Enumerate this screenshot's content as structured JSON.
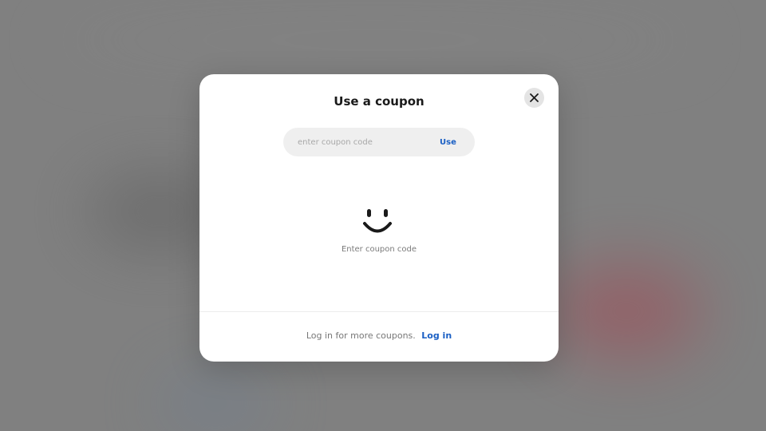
{
  "modal": {
    "title": "Use a coupon",
    "close_icon": "close-icon"
  },
  "coupon": {
    "placeholder": "enter coupon code",
    "value": "",
    "use_label": "Use"
  },
  "empty_state": {
    "icon": "smiley-icon",
    "text": "Enter coupon code"
  },
  "footer": {
    "text": "Log in for more coupons.",
    "login_label": "Log in"
  },
  "colors": {
    "accent": "#1a5fc4",
    "backdrop": "#808080"
  }
}
